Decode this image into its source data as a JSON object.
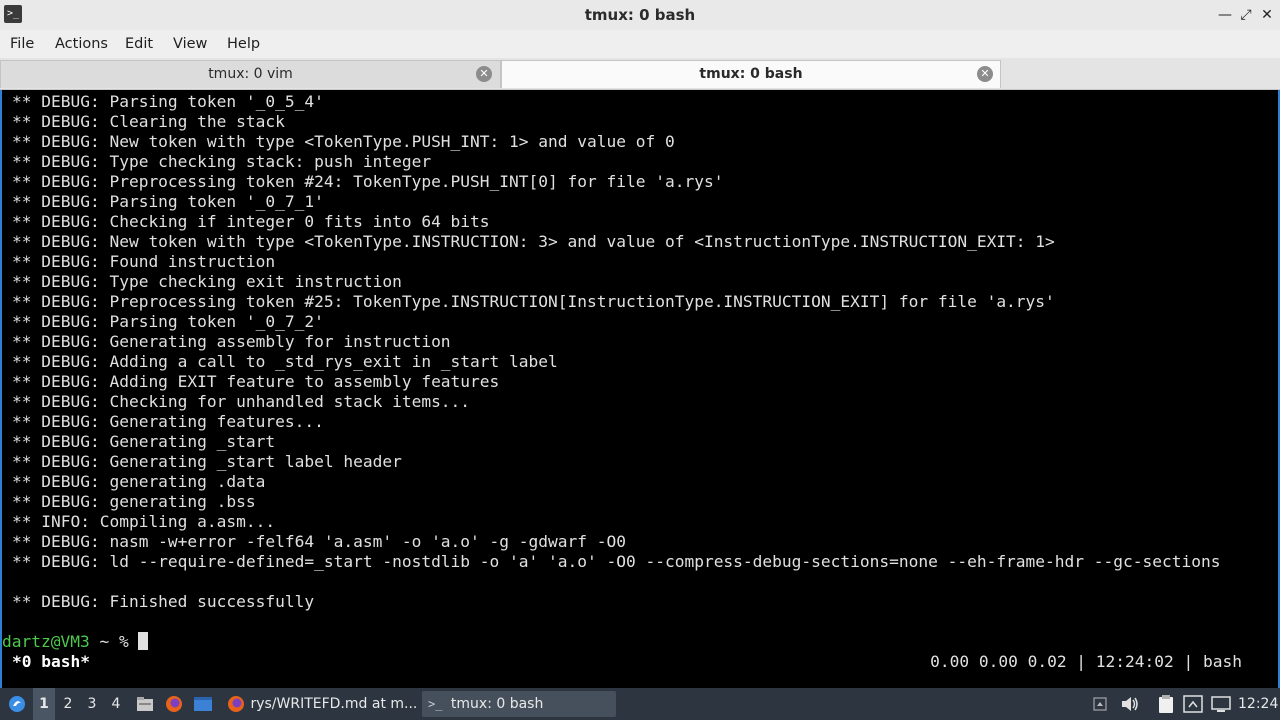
{
  "window": {
    "title": "tmux: 0 bash"
  },
  "menubar": {
    "items": [
      "File",
      "Actions",
      "Edit",
      "View",
      "Help"
    ]
  },
  "tabs": [
    {
      "label": "tmux: 0 vim",
      "active": false
    },
    {
      "label": "tmux: 0 bash",
      "active": true
    }
  ],
  "terminal": {
    "lines": [
      "** DEBUG: Parsing token '_0_5_4'",
      "** DEBUG: Clearing the stack",
      "** DEBUG: New token with type <TokenType.PUSH_INT: 1> and value of 0",
      "** DEBUG: Type checking stack: push integer",
      "** DEBUG: Preprocessing token #24: TokenType.PUSH_INT[0] for file 'a.rys'",
      "** DEBUG: Parsing token '_0_7_1'",
      "** DEBUG: Checking if integer 0 fits into 64 bits",
      "** DEBUG: New token with type <TokenType.INSTRUCTION: 3> and value of <InstructionType.INSTRUCTION_EXIT: 1>",
      "** DEBUG: Found instruction",
      "** DEBUG: Type checking exit instruction",
      "** DEBUG: Preprocessing token #25: TokenType.INSTRUCTION[InstructionType.INSTRUCTION_EXIT] for file 'a.rys'",
      "** DEBUG: Parsing token '_0_7_2'",
      "** DEBUG: Generating assembly for instruction",
      "** DEBUG: Adding a call to _std_rys_exit in _start label",
      "** DEBUG: Adding EXIT feature to assembly features",
      "** DEBUG: Checking for unhandled stack items...",
      "** DEBUG: Generating features...",
      "** DEBUG: Generating _start",
      "** DEBUG: Generating _start label header",
      "** DEBUG: generating .data",
      "** DEBUG: generating .bss",
      "** INFO: Compiling a.asm...",
      "** DEBUG: nasm -w+error -felf64 'a.asm' -o 'a.o' -g -gdwarf -O0",
      "** DEBUG: ld --require-defined=_start -nostdlib -o 'a' 'a.o' -O0 --compress-debug-sections=none --eh-frame-hdr --gc-sections",
      "",
      "** DEBUG: Finished successfully"
    ],
    "prompt_user": "dartz@VM3",
    "prompt_rest": " ~ % "
  },
  "tmux_status": {
    "window": "*0 bash*",
    "right": "0.00 0.00 0.02 | 12:24:02 | bash"
  },
  "taskbar": {
    "desktops": [
      "1",
      "2",
      "3",
      "4"
    ],
    "active_desktop": "1",
    "tasks": [
      {
        "label": "rys/WRITEFD.md at m...",
        "icon": "firefox-icon",
        "active": false
      },
      {
        "label": "tmux: 0 bash",
        "icon": "terminal-icon",
        "active": true
      }
    ],
    "clock": "12:24"
  },
  "colors": {
    "terminal_bg": "#000000",
    "terminal_fg": "#e0e0e0",
    "prompt_user": "#4ec94e",
    "terminal_border": "#2c7fd1",
    "taskbar_bg": "#2d3640"
  }
}
